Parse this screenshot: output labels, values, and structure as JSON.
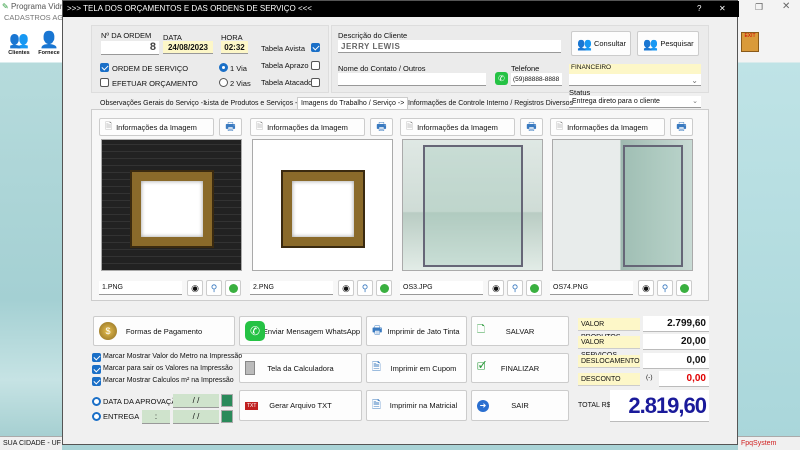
{
  "app": {
    "title": "Programa Vidr",
    "menu": [
      "CADASTROS",
      "AG"
    ],
    "toolbar": [
      "Clientes",
      "Fornece"
    ],
    "status_left": "SUA CIDADE - UF 2",
    "status_right": "FpqSystem"
  },
  "dialog": {
    "title": ">>> TELA DOS ORÇAMENTOS E DAS ORDENS DE SERVIÇO <<<",
    "help": "?"
  },
  "order": {
    "num_label": "Nº DA ORDEM",
    "num": "8",
    "date_label": "DATA",
    "date": "24/08/2023",
    "time_label": "HORA",
    "time": "02:32",
    "ordem_servico": {
      "label": "ORDEM DE SERVIÇO",
      "checked": true
    },
    "orcamento": {
      "label": "EFETUAR ORÇAMENTO",
      "checked": false
    },
    "via1": {
      "label": "1 Via",
      "selected": true
    },
    "via2": {
      "label": "2 Vias",
      "selected": false
    },
    "tabela_avista": {
      "label": "Tabela Avista",
      "checked": true
    },
    "tabela_aprazo": {
      "label": "Tabela Aprazo",
      "checked": false
    },
    "tabela_atacado": {
      "label": "Tabela Atacado",
      "checked": false
    }
  },
  "client": {
    "desc_label": "Descrição do Cliente",
    "desc": "JERRY LEWIS",
    "contact_label": "Nome do Contato / Outros",
    "contact": "",
    "phone_label": "Telefone",
    "phone": "(59)88888-8888",
    "consultar": "Consultar",
    "pesquisar": "Pesquisar",
    "financeiro_label": "FINANCEIRO",
    "financeiro": "",
    "status_label": "Status",
    "status": "Entrega direto para o cliente"
  },
  "tabs": [
    {
      "label": "Observações Gerais do Serviço ->"
    },
    {
      "label": "Lista de Produtos e Serviços ->"
    },
    {
      "label": "Imagens do Trabalho / Serviço ->"
    },
    {
      "label": "Informações de Controle Interno / Registros Diversos"
    }
  ],
  "images": [
    {
      "info": "Informações da Imagem",
      "file": "1.PNG",
      "kind": "frame-dark"
    },
    {
      "info": "Informações da Imagem",
      "file": "2.PNG",
      "kind": "frame-light"
    },
    {
      "info": "Informações da Imagem",
      "file": "OS3.JPG",
      "kind": "glass"
    },
    {
      "info": "Informações da Imagem",
      "file": "OS74.PNG",
      "kind": "glass2"
    }
  ],
  "actions": {
    "formas": "Formas de Pagamento",
    "whatsapp": "Enviar Mensagem WhatsApp",
    "jato": "Imprimir de Jato Tinta",
    "salvar": "SALVAR",
    "calc": "Tela da Calculadora",
    "cupom": "Imprimir em Cupom",
    "finalizar": "FINALIZAR",
    "txt": "Gerar Arquivo TXT",
    "matricial": "Imprimir na Matricial",
    "sair": "SAIR"
  },
  "options": [
    {
      "label": "Marcar Mostrar Valor do Metro na Impressão",
      "checked": true
    },
    {
      "label": "Marcar para sair os Valores na Impressão",
      "checked": true
    },
    {
      "label": "Marcar Mostrar Calculos m² na Impressão",
      "checked": true
    }
  ],
  "dates": {
    "aprov_label": "DATA DA APROVAÇÃO",
    "aprov": " / /",
    "entrega_label": "ENTREGA",
    "entrega_time": ":",
    "entrega": " / /"
  },
  "totals": {
    "produtos_label": "VALOR PRODUTOS",
    "produtos": "2.799,60",
    "servicos_label": "VALOR SERVICOS",
    "servicos": "20,00",
    "desloc_label": "DESLOCAMENTO",
    "desloc": "0,00",
    "desconto_label": "DESCONTO",
    "desconto_sign": "(-)",
    "desconto": "0,00",
    "total_label": "TOTAL R$",
    "total": "2.819,60"
  },
  "colors": {
    "accent": "#1a6fc7",
    "total": "#1a1a9a",
    "discount": "#e00000"
  }
}
